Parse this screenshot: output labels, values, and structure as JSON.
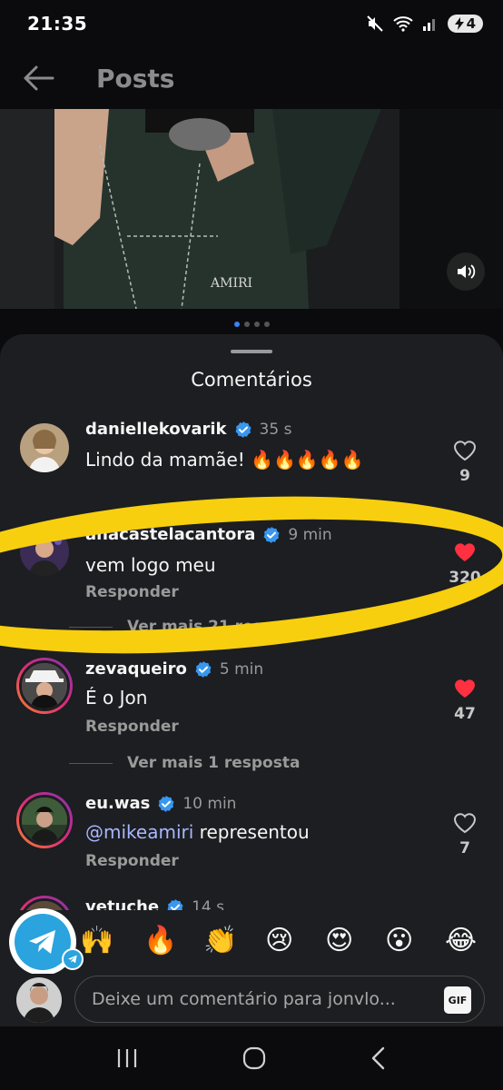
{
  "status_bar": {
    "time": "21:35",
    "battery_level": "4"
  },
  "header": {
    "title": "Posts",
    "back_icon": "arrow-left-icon"
  },
  "post": {
    "carousel_dots": 4,
    "active_dot": 0,
    "mute_icon": "speaker-icon"
  },
  "sheet": {
    "title": "Comentários"
  },
  "comments": [
    {
      "username": "daniellekovarik",
      "time": "35 s",
      "text": "Lindo da mamãe! 🔥🔥🔥🔥🔥",
      "likes": "9",
      "liked": false
    },
    {
      "username": "anacastelacantora",
      "time": "9 min",
      "text": "vem logo meu",
      "reply_label": "Responder",
      "likes": "320",
      "liked": true,
      "more_replies": "Ver mais 21 respostas"
    },
    {
      "username": "zevaqueiro",
      "time": "5 min",
      "text": "É o Jon",
      "reply_label": "Responder",
      "likes": "47",
      "liked": true,
      "more_replies": "Ver mais 1 resposta"
    },
    {
      "username": "eu.was",
      "time": "10 min",
      "mention": "@mikeamiri",
      "text": " representou",
      "reply_label": "Responder",
      "likes": "7",
      "liked": false
    },
    {
      "username": "vetuche",
      "time": "14 s"
    }
  ],
  "emojis": [
    "🙌",
    "🔥",
    "👏",
    "😢",
    "😍",
    "😮",
    "😂"
  ],
  "input": {
    "placeholder": "Deixe um comentário para jonvlo...",
    "gif_label": "GIF"
  },
  "colors": {
    "like_red": "#ff3040",
    "verified_blue": "#3897f0",
    "annotation_yellow": "#f7cf0e"
  }
}
